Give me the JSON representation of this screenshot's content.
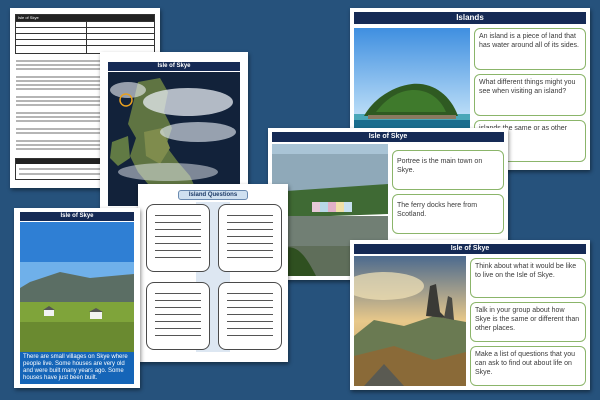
{
  "colors": {
    "background": "#26527c",
    "title_bar": "#152a55",
    "cell_border": "#8bb56a",
    "caption_box": "#1565b8"
  },
  "info_sheet": {
    "title": "Isle of Skye"
  },
  "map_sheet": {
    "title": "Isle of Skye"
  },
  "questions_sheet": {
    "title": "Island Questions"
  },
  "photo_sheet": {
    "title": "Isle of Skye",
    "caption": "There are small villages on Skye where people live. Some houses are very old and were built many years ago. Some houses have just been built."
  },
  "islands_card": {
    "title": "Islands",
    "cells": [
      "An island is a piece of land that has water around all of its sides.",
      "What different things might you see when visiting an island?",
      "islands the same or as other places?"
    ]
  },
  "portree_card": {
    "title": "Isle of Skye",
    "cells": [
      "Portree is the main town on Skye.",
      "The ferry docks here from Scotland."
    ]
  },
  "skye_card": {
    "title": "Isle of Skye",
    "cells": [
      "Think about what it would be like to live on the Isle of Skye.",
      "Talk in your group about how Skye is the same or different than other places.",
      "Make a list of questions that you can ask to find out about life on Skye."
    ]
  }
}
